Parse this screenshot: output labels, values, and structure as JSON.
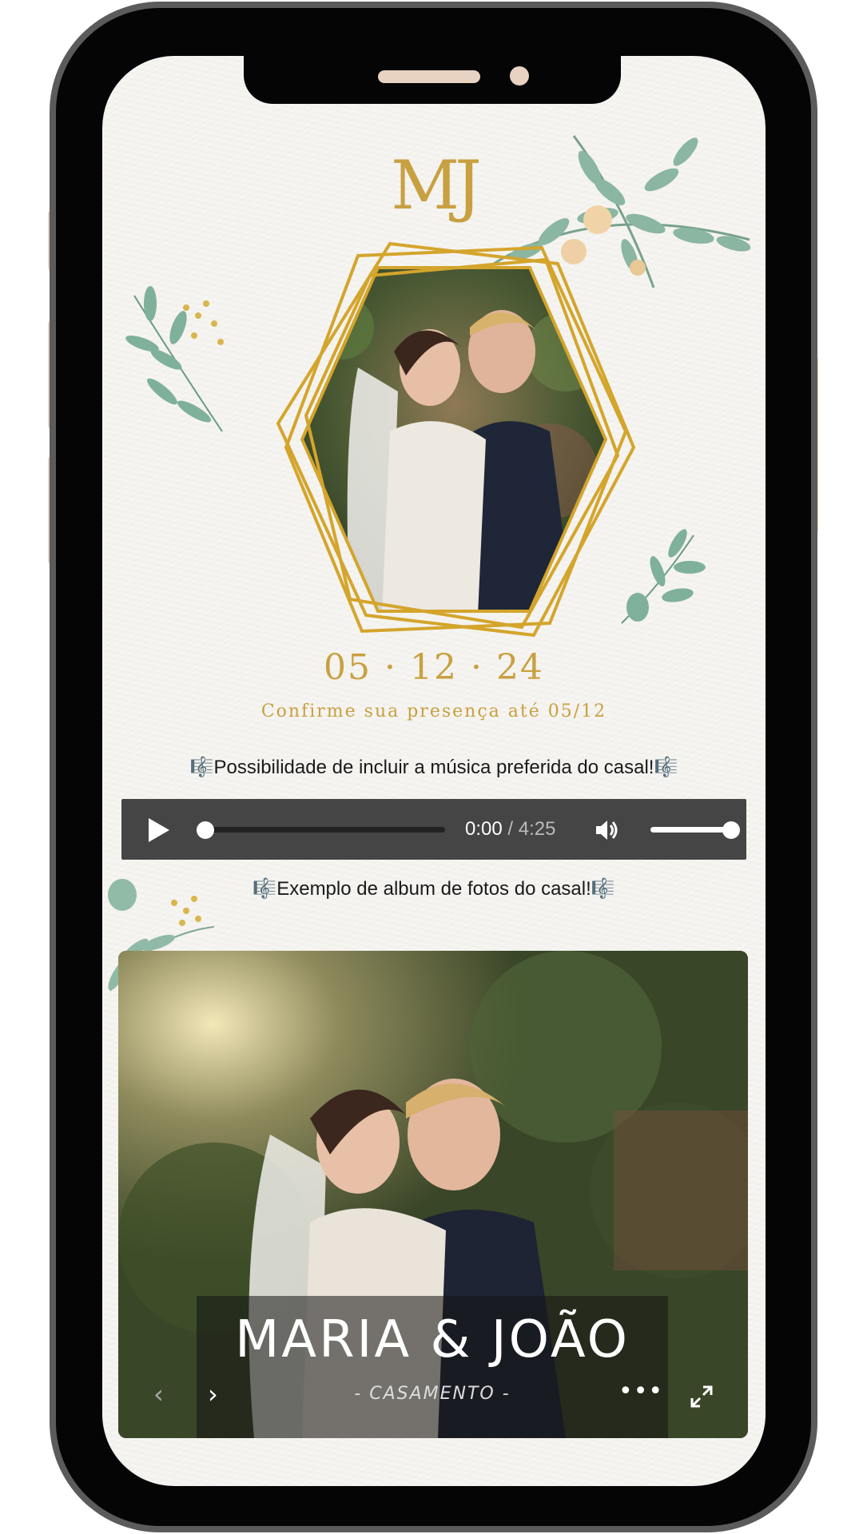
{
  "invitation": {
    "monogram": "MJ",
    "date": "05 · 12 · 24",
    "rsvp": "Confirme sua presença até 05/12"
  },
  "music_note": "🎼Possibilidade de incluir a música preferida do casal!🎼",
  "audio_player": {
    "current_time": "0:00",
    "separator": " / ",
    "total_time": "4:25",
    "progress": 0,
    "volume": 0.85
  },
  "album_note": "🎼Exemplo de album de fotos do casal!🎼",
  "album": {
    "title": "MARIA  & JOÃO",
    "subtitle": "- CASAMENTO -",
    "prev_icon": "chevron-left-icon",
    "next_icon": "chevron-right-icon",
    "more_icon": "more-dots-icon",
    "fullscreen_icon": "fullscreen-icon"
  },
  "colors": {
    "gold": "#c9a041",
    "paper": "#f6f5f1",
    "player_bg": "#454545",
    "leaf": "#6fa58c"
  }
}
